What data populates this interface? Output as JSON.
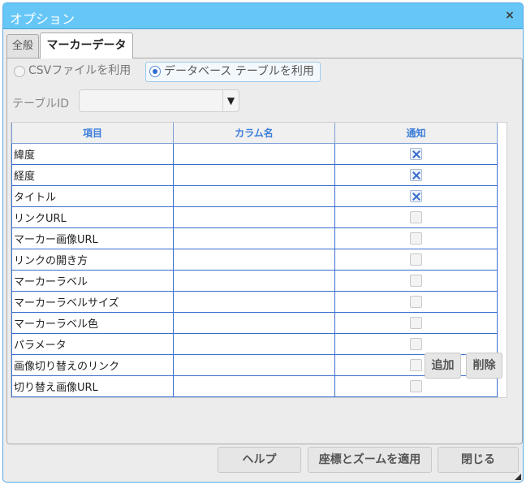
{
  "dialog": {
    "title": "オプション",
    "close_symbol": "×"
  },
  "tabs": [
    {
      "label": "全般",
      "active": false
    },
    {
      "label": "マーカーデータ",
      "active": true
    }
  ],
  "source": {
    "options": [
      {
        "label": "CSVファイルを利用",
        "selected": false
      },
      {
        "label": "データベース テーブルを利用",
        "selected": true
      }
    ]
  },
  "table_id": {
    "label": "テーブルID",
    "value": "",
    "arrow": "▼"
  },
  "grid": {
    "columns": [
      "項目",
      "カラム名",
      "通知"
    ],
    "rows": [
      {
        "item": "緯度",
        "column": "",
        "notify": true
      },
      {
        "item": "経度",
        "column": "",
        "notify": true
      },
      {
        "item": "タイトル",
        "column": "",
        "notify": true
      },
      {
        "item": "リンクURL",
        "column": "",
        "notify": false
      },
      {
        "item": "マーカー画像URL",
        "column": "",
        "notify": false
      },
      {
        "item": "リンクの開き方",
        "column": "",
        "notify": false
      },
      {
        "item": "マーカーラベル",
        "column": "",
        "notify": false
      },
      {
        "item": "マーカーラベルサイズ",
        "column": "",
        "notify": false
      },
      {
        "item": "マーカーラベル色",
        "column": "",
        "notify": false
      },
      {
        "item": "パラメータ",
        "column": "",
        "notify": false
      },
      {
        "item": "画像切り替えのリンク",
        "column": "",
        "notify": false
      },
      {
        "item": "切り替え画像URL",
        "column": "",
        "notify": false
      }
    ]
  },
  "grid_buttons": {
    "add": "追加",
    "delete": "削除"
  },
  "footer": {
    "help": "ヘルプ",
    "apply": "座標とズームを適用",
    "close": "閉じる"
  },
  "colors": {
    "titlebar": "#66c7f7",
    "grid_border": "#3a6fce",
    "header_text": "#3b7dd8",
    "check_mark": "#3b6fcf"
  }
}
